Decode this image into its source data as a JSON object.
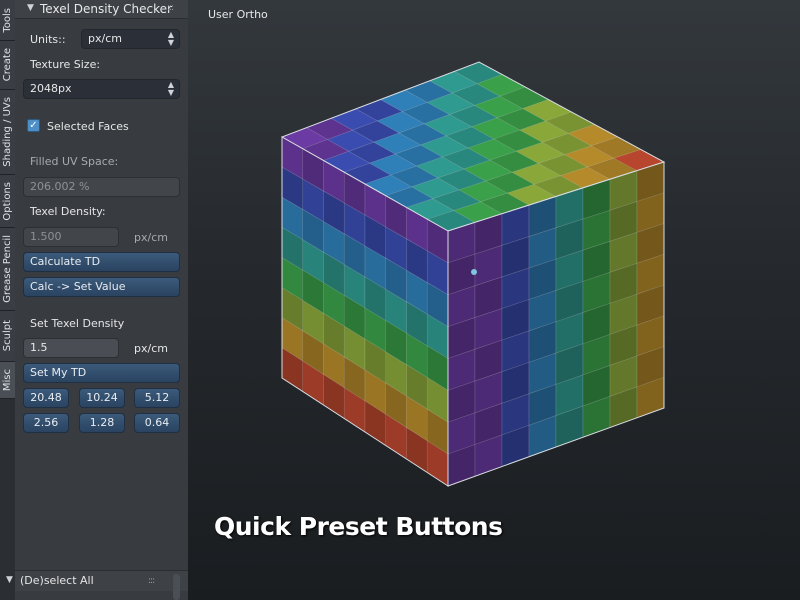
{
  "tabs": [
    "Tools",
    "Create",
    "Shading / UVs",
    "Options",
    "Grease Pencil",
    "Sculpt",
    "Misc"
  ],
  "panel": {
    "title": "Texel Density Checker",
    "units_label": "Units::",
    "units_value": "px/cm",
    "texture_size_label": "Texture Size:",
    "texture_size_value": "2048px",
    "selected_faces_label": "Selected Faces",
    "selected_faces_checked": true,
    "filled_uv_label": "Filled UV Space:",
    "filled_uv_value": "206.002 %",
    "texel_density_label": "Texel Density:",
    "texel_density_value": "1.500",
    "texel_density_unit": "px/cm",
    "calculate_button": "Calculate TD",
    "calc_set_button": "Calc -> Set Value",
    "set_texel_density_label": "Set Texel Density",
    "set_value": "1.5",
    "set_unit": "px/cm",
    "set_my_td_button": "Set My TD",
    "presets": [
      "20.48",
      "10.24",
      "5.12",
      "2.56",
      "1.28",
      "0.64"
    ]
  },
  "bottom_panel": {
    "title": "(De)select All"
  },
  "viewport": {
    "view_label": "User Ortho",
    "caption": "Quick Preset Buttons"
  },
  "colors": {
    "accent": "#4e8fc7",
    "button": "#2f4a6a",
    "panel_bg": "#383b40"
  }
}
